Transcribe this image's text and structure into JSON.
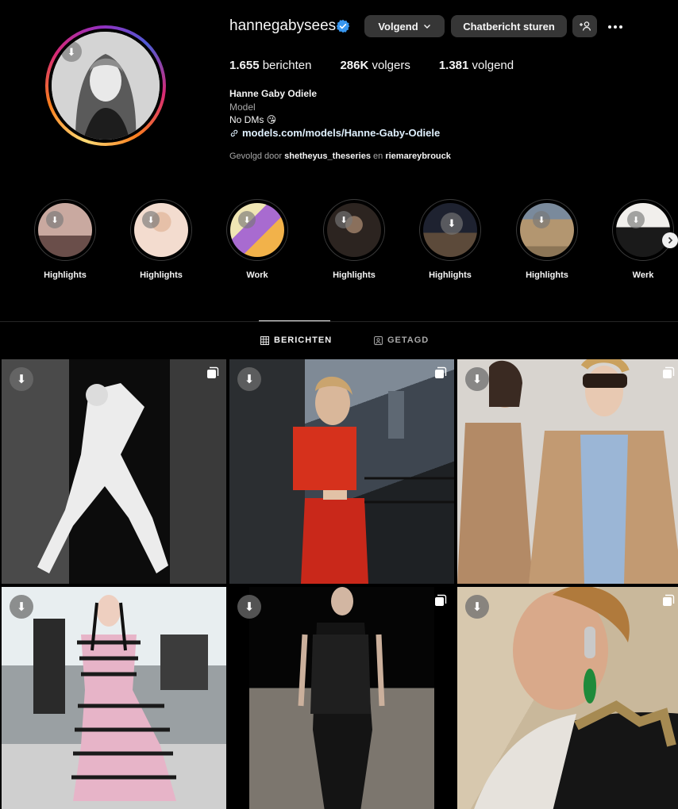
{
  "profile": {
    "username": "hannegabysees",
    "verified_icon": "verified-badge-icon",
    "follow_button": "Volgend",
    "message_button": "Chatbericht sturen",
    "stats": {
      "posts_count": "1.655",
      "posts_label": "berichten",
      "followers_count": "286K",
      "followers_label": "volgers",
      "following_count": "1.381",
      "following_label": "volgend"
    },
    "bio": {
      "name": "Hanne Gaby Odiele",
      "category": "Model",
      "text": "No DMs 😘",
      "link": "models.com/models/Hanne-Gaby-Odiele"
    },
    "followed_by": {
      "prefix": "Gevolgd door",
      "user1": "shetheyus_theseries",
      "joiner": "en",
      "user2": "riemareybrouck"
    }
  },
  "highlights": [
    {
      "label": "Highlights",
      "color": "#b89a8c"
    },
    {
      "label": "Highlights",
      "color": "#d9b7a3"
    },
    {
      "label": "Work",
      "color": "#e8d48a"
    },
    {
      "label": "Highlights",
      "color": "#3b3330"
    },
    {
      "label": "Highlights",
      "color": "#2a2c36"
    },
    {
      "label": "Highlights",
      "color": "#a58a66"
    },
    {
      "label": "Werk",
      "color": "#e9e6e2"
    }
  ],
  "tabs": {
    "posts": "BERICHTEN",
    "tagged": "GETAGD"
  },
  "colors": {
    "background": "#000000",
    "button_bg": "#363636",
    "verified": "#3897f0",
    "link": "#e0f1ff",
    "secondary_text": "#a8a8a8"
  }
}
